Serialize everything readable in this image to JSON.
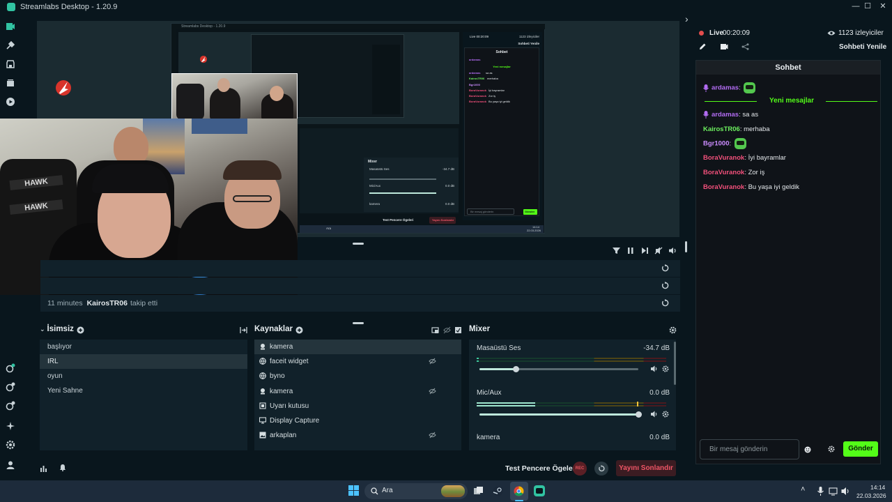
{
  "window": {
    "title": "Streamlabs Desktop - 1.20.9",
    "controls": [
      "—",
      "☐",
      "✕"
    ]
  },
  "nested_preview": {
    "title": "Streamlabs Desktop - 1.20.9",
    "chat_status": "Live 00:20:09",
    "viewers": "1123 izleyiciler",
    "chat_title": "Sohbet",
    "refresh": "Sohbeti Yenile",
    "new_messages": "Yeni mesajlar",
    "mixer_title": "Mixer",
    "input_placeholder": "Bir mesaj gönderin",
    "send": "Gönder",
    "test_label": "Test Pencere Ögeleri",
    "end_stream": "Yayını Sonlandır",
    "search": "Ara",
    "time": "14:14",
    "date": "22.03.2026",
    "mixer_rows": [
      {
        "name": "Masaüstü Ses",
        "db": "-34.7 dB"
      },
      {
        "name": "Mic/Aux",
        "db": "0.0 dB"
      },
      {
        "name": "kamera",
        "db": "0.0 dB"
      }
    ],
    "chat_lines": [
      {
        "user": "ardamas",
        "text": ""
      },
      {
        "user": "ardamas",
        "text": "sa as"
      },
      {
        "user": "KairosTR06",
        "text": "merhaba"
      },
      {
        "user": "Bgr1000",
        "text": ""
      },
      {
        "user": "BoraVuranok",
        "text": "İyi bayramlar"
      },
      {
        "user": "BoraVuranok",
        "text": "Zor iş"
      },
      {
        "user": "BoraVuranok",
        "text": "Bu yaşa iyi geldik"
      }
    ]
  },
  "events": {
    "rows": [
      {
        "time": "",
        "user": "",
        "action": ""
      },
      {
        "time": "",
        "user": "",
        "action": ""
      },
      {
        "time": "11 minutes",
        "user": "KairosTR06",
        "action": "takip etti"
      }
    ]
  },
  "scenes": {
    "title": "İsimsiz",
    "items": [
      "başlıyor",
      "IRL",
      "oyun",
      "Yeni Sahne"
    ],
    "selected": "IRL"
  },
  "sources": {
    "title": "Kaynaklar",
    "items": [
      {
        "label": "kamera",
        "icon": "webcam-icon",
        "hidden": false,
        "selected": true
      },
      {
        "label": "faceit widget",
        "icon": "globe-icon",
        "hidden": true,
        "selected": false
      },
      {
        "label": "byno",
        "icon": "globe-icon",
        "hidden": false,
        "selected": false
      },
      {
        "label": "kamera",
        "icon": "webcam-icon",
        "hidden": true,
        "selected": false
      },
      {
        "label": "Uyarı kutusu",
        "icon": "alertbox-icon",
        "hidden": false,
        "selected": false
      },
      {
        "label": "Display Capture",
        "icon": "monitor-icon",
        "hidden": false,
        "selected": false
      },
      {
        "label": "arkaplan",
        "icon": "image-icon",
        "hidden": true,
        "selected": false
      }
    ]
  },
  "mixer": {
    "title": "Mixer",
    "channels": [
      {
        "name": "Masaüstü Ses",
        "db": "-34.7 dB",
        "volume": 0.23,
        "level": 0.01
      },
      {
        "name": "Mic/Aux",
        "db": "0.0 dB",
        "volume": 1.0,
        "level": 0.31
      },
      {
        "name": "kamera",
        "db": "0.0 dB"
      }
    ]
  },
  "footer": {
    "test_label": "Test Pencere Ögeleri",
    "rec": "REC",
    "end_stream": "Yayını Sonlandır"
  },
  "chat": {
    "status": "Live",
    "uptime": "00:20:09",
    "viewers": "1123 izleyiciler",
    "refresh": "Sohbeti Yenile",
    "title": "Sohbet",
    "new_messages": "Yeni mesajlar",
    "messages": [
      {
        "user": "ardamas",
        "sep": ":",
        "text": "",
        "color": "#b26cf2",
        "badge": true,
        "emote": true
      },
      {
        "user": "ardamas",
        "sep": ":",
        "text": "sa as",
        "color": "#b26cf2",
        "badge": true,
        "emote": false
      },
      {
        "user": "KairosTR06",
        "sep": ":",
        "text": "merhaba",
        "color": "#6df05f",
        "badge": false,
        "emote": false
      },
      {
        "user": "Bgr1000",
        "sep": ":",
        "text": "",
        "color": "#cc8cff",
        "badge": false,
        "emote": true
      },
      {
        "user": "BoraVuranok",
        "sep": ":",
        "text": "İyi bayramlar",
        "color": "#f2507b",
        "badge": false,
        "emote": false
      },
      {
        "user": "BoraVuranok",
        "sep": ":",
        "text": "Zor iş",
        "color": "#f2507b",
        "badge": false,
        "emote": false
      },
      {
        "user": "BoraVuranok",
        "sep": ":",
        "text": "Bu yaşa iyi geldik",
        "color": "#f2507b",
        "badge": false,
        "emote": false
      }
    ],
    "input_placeholder": "Bir mesaj gönderin",
    "send": "Gönder"
  },
  "taskbar": {
    "search": "Ara",
    "time": "14:14",
    "date": "22.03.2026"
  },
  "colors": {
    "accent": "#31c3a2",
    "kick_green": "#53fc18",
    "live_red": "#e24d4d"
  }
}
